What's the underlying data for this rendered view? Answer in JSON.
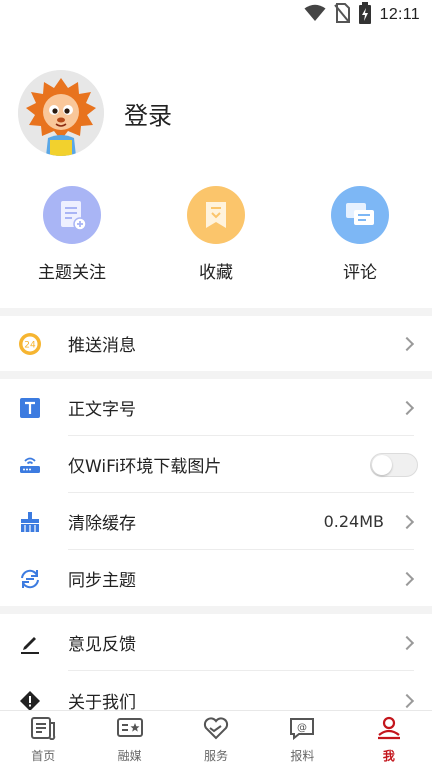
{
  "status_bar": {
    "time": "12:11"
  },
  "profile": {
    "login_label": "登录"
  },
  "quick_actions": [
    {
      "label": "主题关注",
      "icon": "topic-follow-icon",
      "color": "#a9b5f5"
    },
    {
      "label": "收藏",
      "icon": "bookmark-icon",
      "color": "#fbc56b"
    },
    {
      "label": "评论",
      "icon": "comment-icon",
      "color": "#7db7f5"
    }
  ],
  "menu": {
    "push": {
      "label": "推送消息",
      "icon": "push-24-icon"
    },
    "font_size": {
      "label": "正文字号",
      "icon": "text-size-icon"
    },
    "wifi_images": {
      "label": "仅WiFi环境下载图片",
      "icon": "router-icon",
      "enabled": false
    },
    "clear_cache": {
      "label": "清除缓存",
      "value": "0.24MB",
      "icon": "broom-icon"
    },
    "sync_topics": {
      "label": "同步主题",
      "icon": "sync-icon"
    },
    "feedback": {
      "label": "意见反馈",
      "icon": "pencil-icon"
    },
    "about": {
      "label": "关于我们",
      "icon": "info-warning-icon"
    }
  },
  "tabs": [
    {
      "label": "首页",
      "icon": "news-icon",
      "active": false
    },
    {
      "label": "融媒",
      "icon": "media-icon",
      "active": false
    },
    {
      "label": "服务",
      "icon": "heart-service-icon",
      "active": false
    },
    {
      "label": "报料",
      "icon": "report-icon",
      "active": false
    },
    {
      "label": "我",
      "icon": "user-icon",
      "active": true
    }
  ],
  "colors": {
    "accent": "#c3151c",
    "icon_blue": "#3c7be0",
    "divider": "#f3f3f3"
  }
}
